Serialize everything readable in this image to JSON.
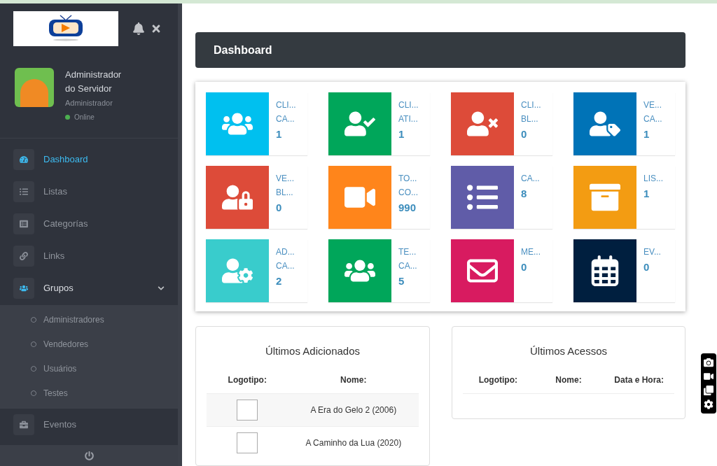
{
  "sidebar": {
    "user": {
      "name": "Administrador do Servidor",
      "role": "Administrador",
      "status": "Online",
      "online": true
    },
    "menu": [
      {
        "label": "Dashboard",
        "selected": true
      },
      {
        "label": "Listas",
        "selected": false
      },
      {
        "label": "Categorías",
        "selected": false
      },
      {
        "label": "Links",
        "selected": false
      },
      {
        "label": "Grupos",
        "selected": false,
        "expanded": true,
        "children": [
          {
            "label": "Administradores"
          },
          {
            "label": "Vendedores"
          },
          {
            "label": "Usuários"
          },
          {
            "label": "Testes"
          }
        ]
      },
      {
        "label": "Eventos",
        "selected": false
      }
    ]
  },
  "header": {
    "title": "Dashboard"
  },
  "tiles": [
    {
      "lines": [
        "CLI...",
        "CA..."
      ],
      "value": "1",
      "color": "#00c0ef"
    },
    {
      "lines": [
        "CLI...",
        "ATI..."
      ],
      "value": "1",
      "color": "#00a65a"
    },
    {
      "lines": [
        "CLI...",
        "BL..."
      ],
      "value": "0",
      "color": "#dd4b39"
    },
    {
      "lines": [
        "VE...",
        "CA..."
      ],
      "value": "1",
      "color": "#0073b7"
    },
    {
      "lines": [
        "VE...",
        "BL..."
      ],
      "value": "0",
      "color": "#dd4b39"
    },
    {
      "lines": [
        "TO...",
        "CO..."
      ],
      "value": "990",
      "color": "#ff851b"
    },
    {
      "lines": [
        "CA..."
      ],
      "value": "8",
      "color": "#605ca8"
    },
    {
      "lines": [
        "LIS..."
      ],
      "value": "1",
      "color": "#f39c12"
    },
    {
      "lines": [
        "AD...",
        "CA..."
      ],
      "value": "2",
      "color": "#39cccc"
    },
    {
      "lines": [
        "TE...",
        "CA..."
      ],
      "value": "5",
      "color": "#00a65a"
    },
    {
      "lines": [
        "ME..."
      ],
      "value": "0",
      "color": "#d81b60"
    },
    {
      "lines": [
        "EV..."
      ],
      "value": "0",
      "color": "#001f3f"
    }
  ],
  "recent_added": {
    "title": "Últimos Adicionados",
    "columns": [
      "Logotipo:",
      "Nome:"
    ],
    "rows": [
      {
        "name": "A Era do Gelo 2 (2006)"
      },
      {
        "name": "A Caminho da Lua (2020)"
      }
    ]
  },
  "recent_access": {
    "title": "Últimos Acessos",
    "columns": [
      "Logotipo:",
      "Nome:",
      "Data e Hora:"
    ]
  }
}
